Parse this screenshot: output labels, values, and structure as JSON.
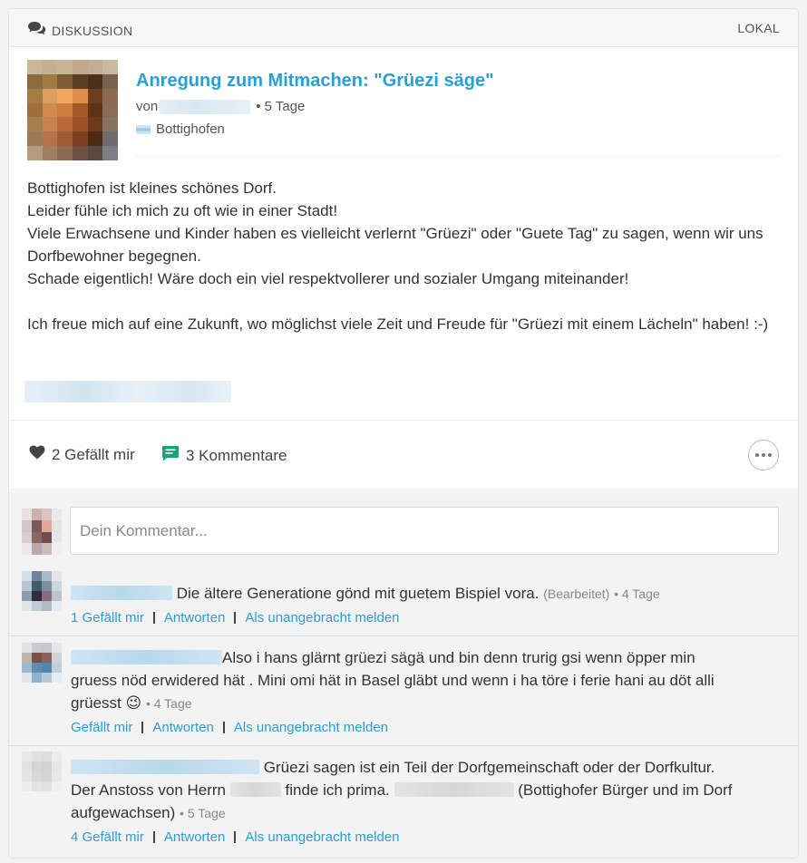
{
  "header": {
    "section_label": "DISKUSSION",
    "scope_label": "LOKAL",
    "icon": "chat-bubbles-icon"
  },
  "post": {
    "title": "Anregung zum Mitmachen: \"Grüezi säge\"",
    "by_prefix": "von",
    "age": "• 5 Tage",
    "location": "Bottighofen",
    "body_paragraphs": [
      "Bottighofen ist kleines schönes Dorf.\nLeider fühle ich mich zu oft wie in einer Stadt!\nViele Erwachsene und Kinder haben es vielleicht verlernt \"Grüezi\" oder \"Guete Tag\" zu sagen, wenn wir uns Dorfbewohner begegnen.\nSchade eigentlich! Wäre doch ein viel respektvollerer und sozialer Umgang miteinander!",
      "Ich freue mich auf eine Zukunft, wo möglichst viele Zeit und Freude für \"Grüezi mit einem Lächeln\" haben! :-)"
    ]
  },
  "actions": {
    "likes_label": "2 Gefällt mir",
    "comments_label": "3 Kommentare",
    "like_icon": "heart-icon",
    "comment_icon": "comment-icon",
    "more_icon": "more-dots-icon"
  },
  "comment_form": {
    "placeholder": "Dein Kommentar..."
  },
  "comments": [
    {
      "text": "Die ältere Generatione gönd mit guetem Bispiel vora.",
      "edited": "(Bearbeitet)",
      "age": "• 4 Tage",
      "like_label": "1 Gefällt mir",
      "reply_label": "Antworten",
      "report_label": "Als unangebracht melden"
    },
    {
      "text": "Also i hans glärnt grüezi sägä und bin denn trurig gsi wenn öpper min gruess nöd erwidered hät . Mini omi hät in Basel gläbt und wenn i ha töre i ferie hani au döt alli grüesst",
      "emoji": "😉",
      "age": "• 4 Tage",
      "like_label": "Gefällt mir",
      "reply_label": "Antworten",
      "report_label": "Als unangebracht melden"
    },
    {
      "text_a": "Grüezi sagen ist ein Teil der Dorfgemeinschaft oder der Dorfkultur. Der Anstoss von Herrn",
      "text_b": "finde ich prima.",
      "text_c": "(Bottighofer Bürger und im Dorf aufgewachsen)",
      "age": "• 5 Tage",
      "like_label": "4 Gefällt mir",
      "reply_label": "Antworten",
      "report_label": "Als unangebracht melden"
    }
  ],
  "colors": {
    "accent": "#2a9fd6",
    "comment_icon": "#1aa37a",
    "text": "#333333",
    "muted": "#888888"
  }
}
